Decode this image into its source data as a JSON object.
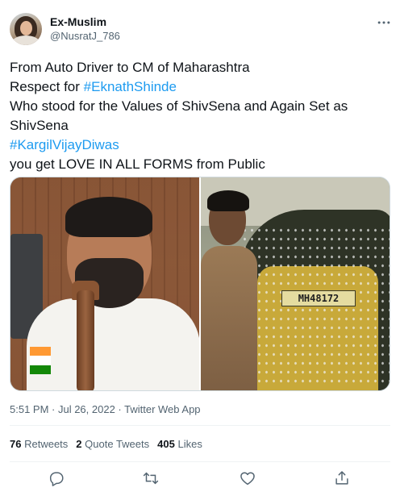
{
  "author": {
    "display_name": "Ex-Muslim",
    "handle": "@NusratJ_786"
  },
  "tweet": {
    "line1": "From Auto Driver to CM of Maharashtra",
    "line2_prefix": "Respect for ",
    "line2_hashtag": "#EknathShinde",
    "line3": "Who stood for the Values of ShivSena and Again Set as",
    "line4": "ShivSena",
    "line5_hashtag": "#KargilVijayDiwas",
    "line6": "you get LOVE IN ALL FORMS from Public"
  },
  "media": {
    "plate_text": "MH48172"
  },
  "meta": {
    "timestamp": "5:51 PM · Jul 26, 2022 · ",
    "source": "Twitter Web App"
  },
  "stats": {
    "retweets_count": "76",
    "retweets_label": "Retweets",
    "quotes_count": "2",
    "quotes_label": "Quote Tweets",
    "likes_count": "405",
    "likes_label": "Likes"
  },
  "icons": {
    "more": "more-horizontal-icon",
    "reply": "reply-icon",
    "retweet": "retweet-icon",
    "like": "heart-icon",
    "share": "share-icon"
  },
  "colors": {
    "link": "#1d9bf0",
    "text": "#0f1419",
    "secondary": "#536471",
    "divider": "#eff3f4"
  }
}
